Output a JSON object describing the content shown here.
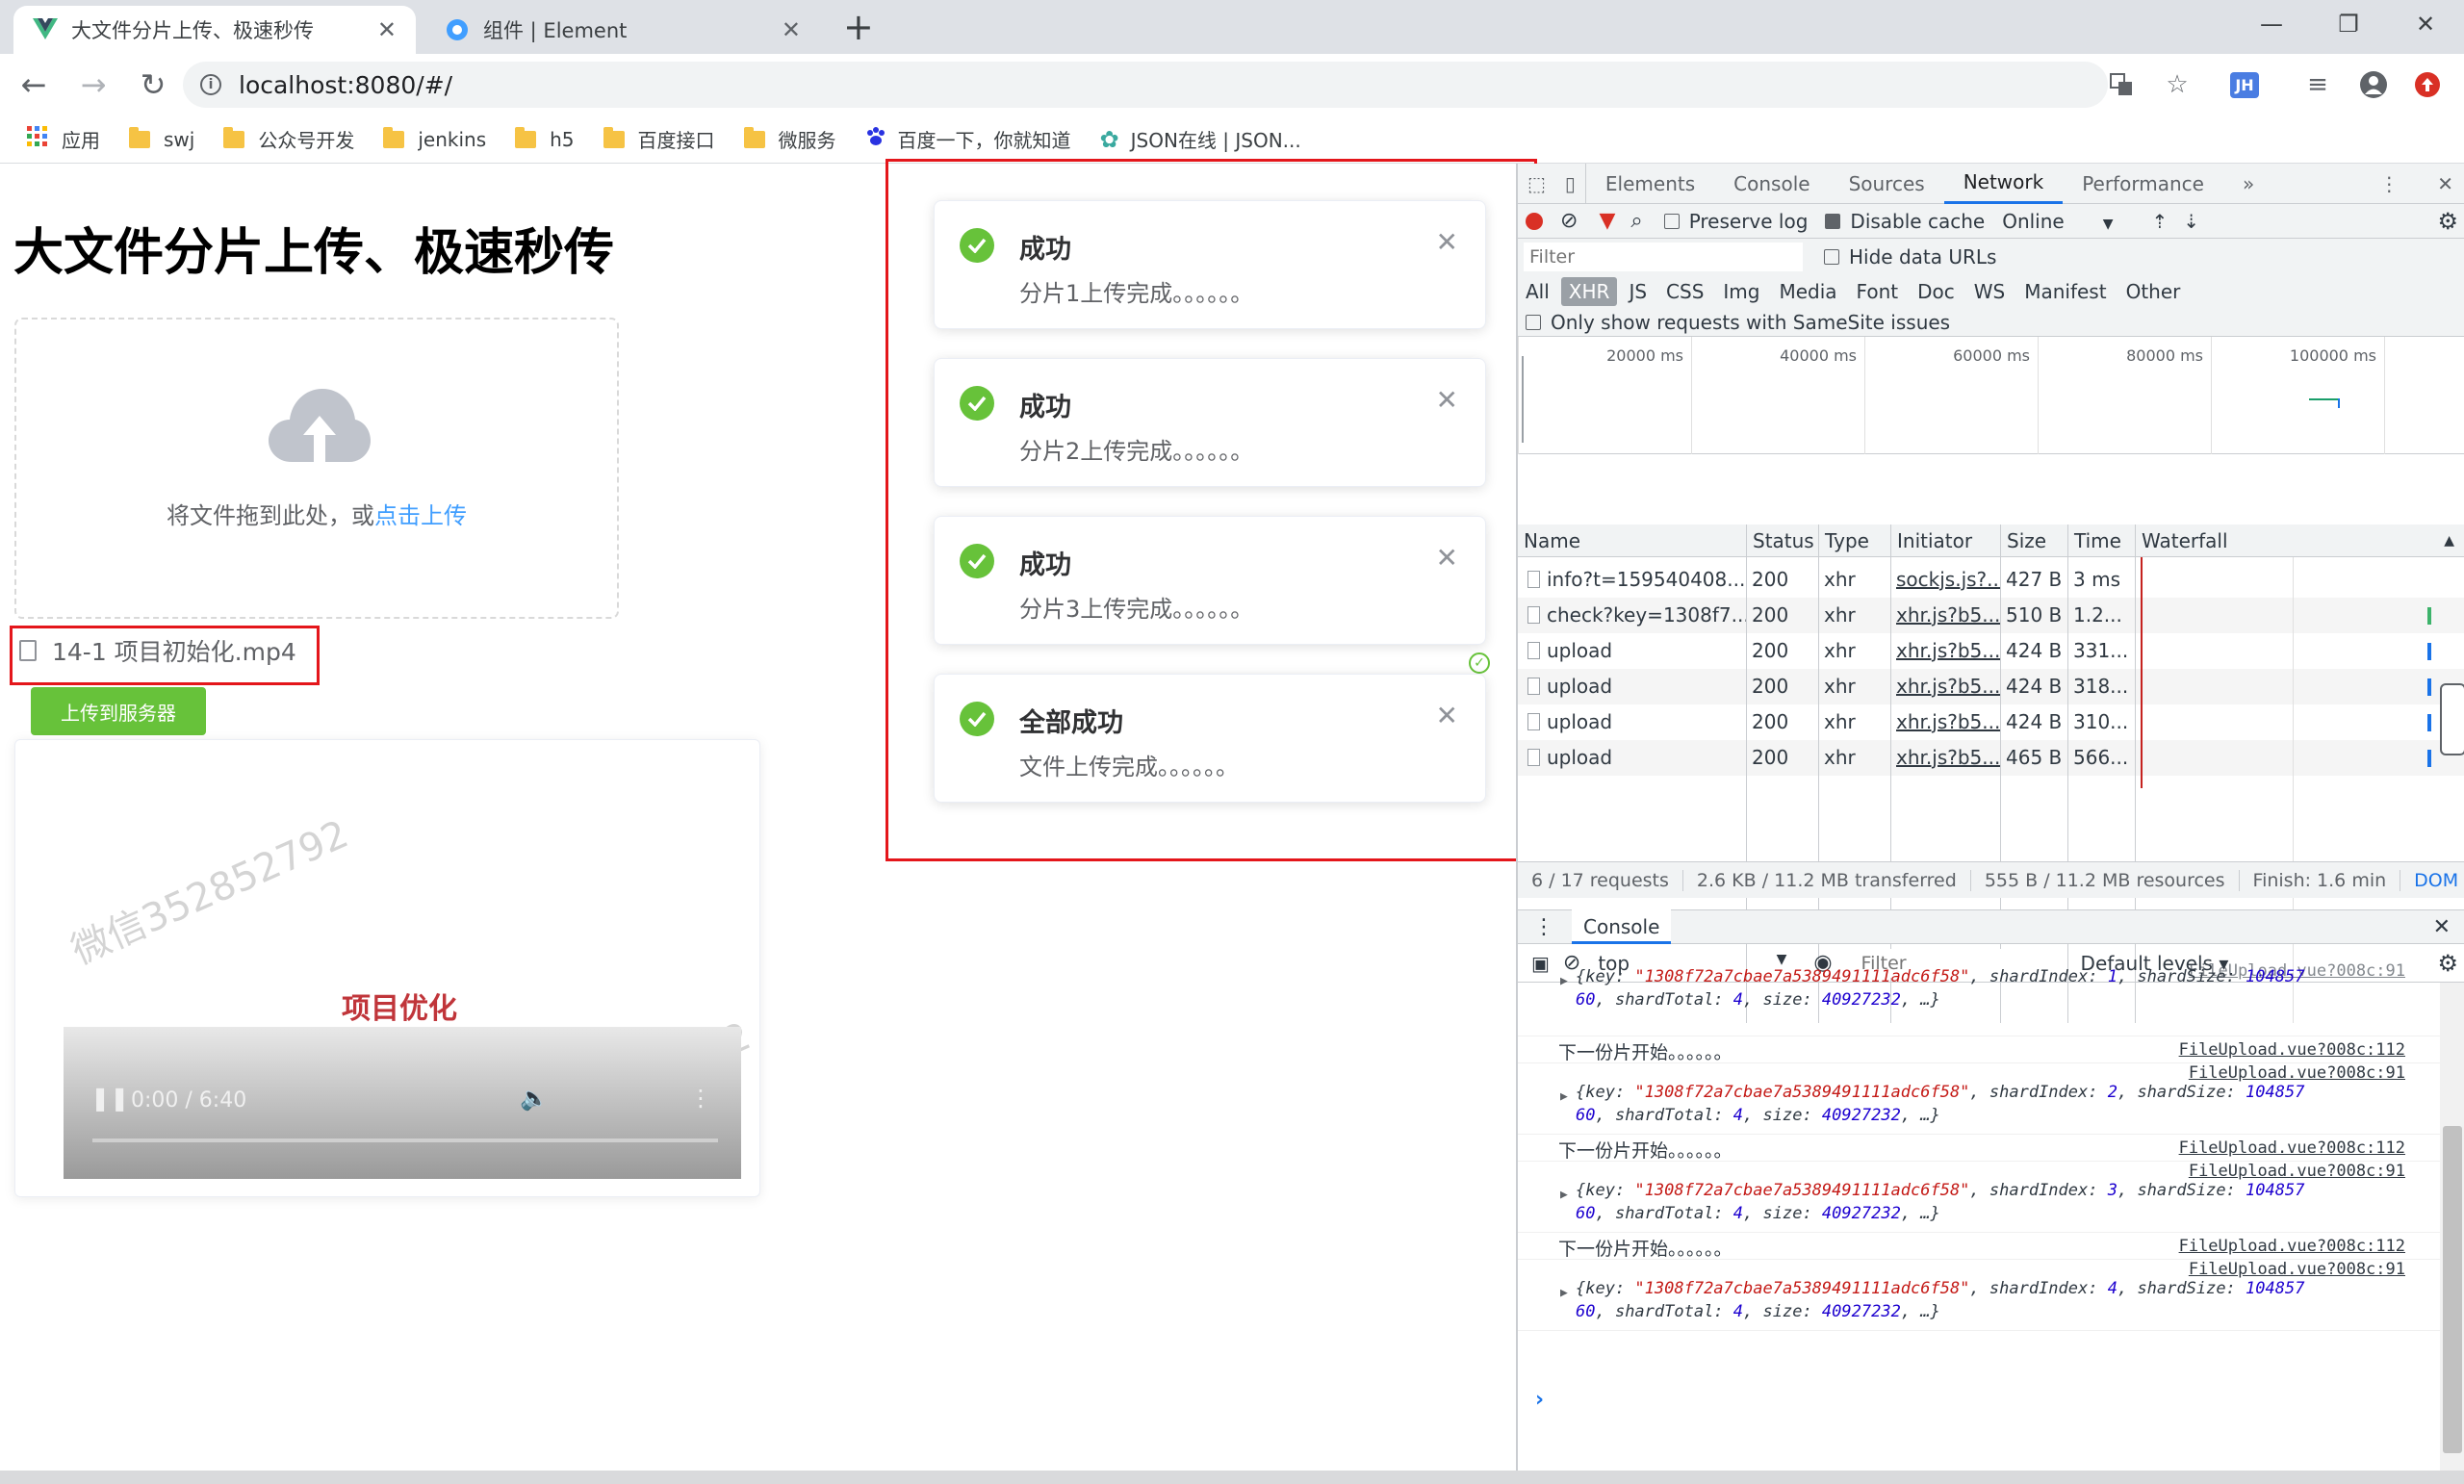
{
  "browser": {
    "tabs": [
      {
        "title": "大文件分片上传、极速秒传",
        "active": true
      },
      {
        "title": "组件 | Element",
        "active": false
      }
    ],
    "url": "localhost:8080/#/",
    "bookmarks": [
      "应用",
      "swj",
      "公众号开发",
      "jenkins",
      "h5",
      "百度接口",
      "微服务",
      "百度一下，你就知道",
      "JSON在线 | JSON..."
    ],
    "profile_badge": "JH"
  },
  "page": {
    "title": "大文件分片上传、极速秒传",
    "drop_text": "将文件拖到此处，或",
    "drop_link": "点击上传",
    "file_name": "14-1 项目初始化.mp4",
    "upload_button": "上传到服务器",
    "video_title": "项目优化",
    "video_watermark": "微信352852792",
    "video_time": "0:00 / 6:40"
  },
  "notifications": [
    {
      "title": "成功",
      "message": "分片1上传完成。。。。。。"
    },
    {
      "title": "成功",
      "message": "分片2上传完成。。。。。。"
    },
    {
      "title": "成功",
      "message": "分片3上传完成。。。。。。"
    },
    {
      "title": "全部成功",
      "message": "文件上传完成。。。。。。"
    }
  ],
  "devtools": {
    "tabs": [
      "Elements",
      "Console",
      "Sources",
      "Network",
      "Performance"
    ],
    "active_tab": "Network",
    "preserve_log": "Preserve log",
    "disable_cache": "Disable cache",
    "throttle": "Online",
    "filter_placeholder": "Filter",
    "hide_data_urls": "Hide data URLs",
    "filter_types": [
      "All",
      "XHR",
      "JS",
      "CSS",
      "Img",
      "Media",
      "Font",
      "Doc",
      "WS",
      "Manifest",
      "Other"
    ],
    "active_filter": "XHR",
    "samesite": "Only show requests with SameSite issues",
    "overview_ticks": [
      "20000 ms",
      "40000 ms",
      "60000 ms",
      "80000 ms",
      "100000 ms"
    ],
    "columns": [
      "Name",
      "Status",
      "Type",
      "Initiator",
      "Size",
      "Time",
      "Waterfall"
    ],
    "requests": [
      {
        "name": "info?t=159540408...",
        "status": "200",
        "type": "xhr",
        "initiator": "sockjs.js?...",
        "size": "427 B",
        "time": "3 ms"
      },
      {
        "name": "check?key=1308f7...",
        "status": "200",
        "type": "xhr",
        "initiator": "xhr.js?b5...",
        "size": "510 B",
        "time": "1.2..."
      },
      {
        "name": "upload",
        "status": "200",
        "type": "xhr",
        "initiator": "xhr.js?b5...",
        "size": "424 B",
        "time": "331..."
      },
      {
        "name": "upload",
        "status": "200",
        "type": "xhr",
        "initiator": "xhr.js?b5...",
        "size": "424 B",
        "time": "318..."
      },
      {
        "name": "upload",
        "status": "200",
        "type": "xhr",
        "initiator": "xhr.js?b5...",
        "size": "424 B",
        "time": "310..."
      },
      {
        "name": "upload",
        "status": "200",
        "type": "xhr",
        "initiator": "xhr.js?b5...",
        "size": "465 B",
        "time": "566..."
      }
    ],
    "summary": {
      "requests": "6 / 17 requests",
      "transferred": "2.6 KB / 11.2 MB transferred",
      "resources": "555 B / 11.2 MB resources",
      "finish": "Finish: 1.6 min",
      "dom": "DOM"
    },
    "console": {
      "title": "Console",
      "context": "top",
      "filter_placeholder": "Filter",
      "levels": "Default levels ▾",
      "next_msg": "下一份片开始。。。。。。",
      "src_log": "FileUpload.vue?008c:91",
      "src_next": "FileUpload.vue?008c:112",
      "key": "\"1308f72a7cbae7a5389491111adc6f58\"",
      "shard_size_a": "104857",
      "shard_size_b": "60",
      "shard_total": "4",
      "size": "40927232",
      "entries": [
        {
          "index": "1"
        },
        {
          "index": "2"
        },
        {
          "index": "3"
        },
        {
          "index": "4"
        }
      ]
    }
  },
  "colors": {
    "success": "#67c23a",
    "link": "#409eff",
    "annotation_red": "#e4161b",
    "active_tab_blue": "#1a73e8"
  }
}
